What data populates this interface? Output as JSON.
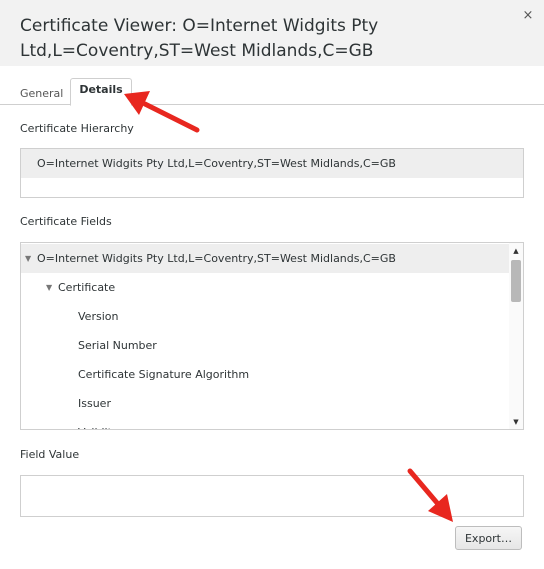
{
  "window": {
    "title": "Certificate Viewer: O=Internet Widgits Pty Ltd,L=Coventry,ST=West Midlands,C=GB",
    "close_glyph": "×"
  },
  "tabs": [
    {
      "label": "General",
      "active": false
    },
    {
      "label": "Details",
      "active": true
    }
  ],
  "hierarchy": {
    "label": "Certificate Hierarchy",
    "items": [
      "O=Internet Widgits Pty Ltd,L=Coventry,ST=West Midlands,C=GB"
    ]
  },
  "fields": {
    "label": "Certificate Fields",
    "rows": [
      {
        "label": "O=Internet Widgits Pty Ltd,L=Coventry,ST=West Midlands,C=GB",
        "expanded": true,
        "selected": true
      },
      {
        "label": "Certificate",
        "expanded": true
      },
      {
        "label": "Version"
      },
      {
        "label": "Serial Number"
      },
      {
        "label": "Certificate Signature Algorithm"
      },
      {
        "label": "Issuer"
      },
      {
        "label": "Validity",
        "expanded": true
      }
    ]
  },
  "field_value": {
    "label": "Field Value",
    "value": ""
  },
  "buttons": {
    "export_label": "Export…"
  },
  "colors": {
    "annotation_arrow": "#e8271f",
    "selection": "#eeeeee"
  },
  "icons": {
    "expander": "triangle-down-icon",
    "close": "close-icon"
  }
}
